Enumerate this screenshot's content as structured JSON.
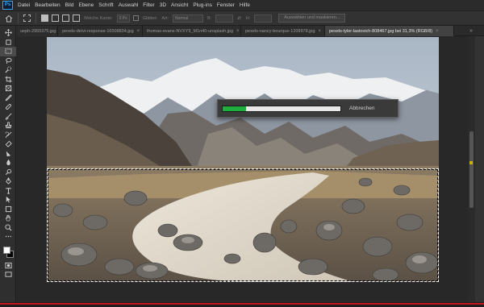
{
  "app": {
    "logo": "Ps"
  },
  "menu": [
    "Datei",
    "Bearbeiten",
    "Bild",
    "Ebene",
    "Schrift",
    "Auswahl",
    "Filter",
    "3D",
    "Ansicht",
    "Plug-ins",
    "Fenster",
    "Hilfe"
  ],
  "options": {
    "soft_edge_label": "Weiche Kante:",
    "soft_edge_value": "0 Px",
    "smooth_label": "Glätten",
    "style_label": "Art:",
    "style_value": "Normal",
    "width_label": "B:",
    "height_label": "H:",
    "select_mask_button": "Auswählen und maskieren..."
  },
  "tabs": [
    {
      "label": "ueph-2955375.jpg",
      "close": "×",
      "active": false
    },
    {
      "label": "pexels-deivi-response-16508834.jpg",
      "close": "×",
      "active": false
    },
    {
      "label": "thomas-evans-NVXY9_M1n40-unsplash.jpg",
      "close": "×",
      "active": false
    },
    {
      "label": "pexels-nancy-bourque-1209978.jpg",
      "close": "×",
      "active": false
    },
    {
      "label": "pexels-tyler-lastovich-808467.jpg bei 31,3% (RGB/8)",
      "close": "×",
      "active": true
    }
  ],
  "progress": {
    "value": 0.2,
    "cancel_label": "Abbrechen"
  },
  "colors": {
    "accent_green": "#1fae3d",
    "red_line": "#c4161c",
    "foreground": "#ffffff",
    "background": "#000000"
  },
  "tools": [
    "move-icon",
    "artboard-icon",
    "marquee-icon",
    "lasso-icon",
    "quick-select-icon",
    "crop-icon",
    "frame-icon",
    "eyedropper-icon",
    "healing-icon",
    "brush-icon",
    "stamp-icon",
    "history-brush-icon",
    "eraser-icon",
    "gradient-icon",
    "blur-icon",
    "dodge-icon",
    "pen-icon",
    "type-icon",
    "path-select-icon",
    "shape-icon",
    "hand-icon",
    "zoom-icon",
    "more-icon"
  ]
}
